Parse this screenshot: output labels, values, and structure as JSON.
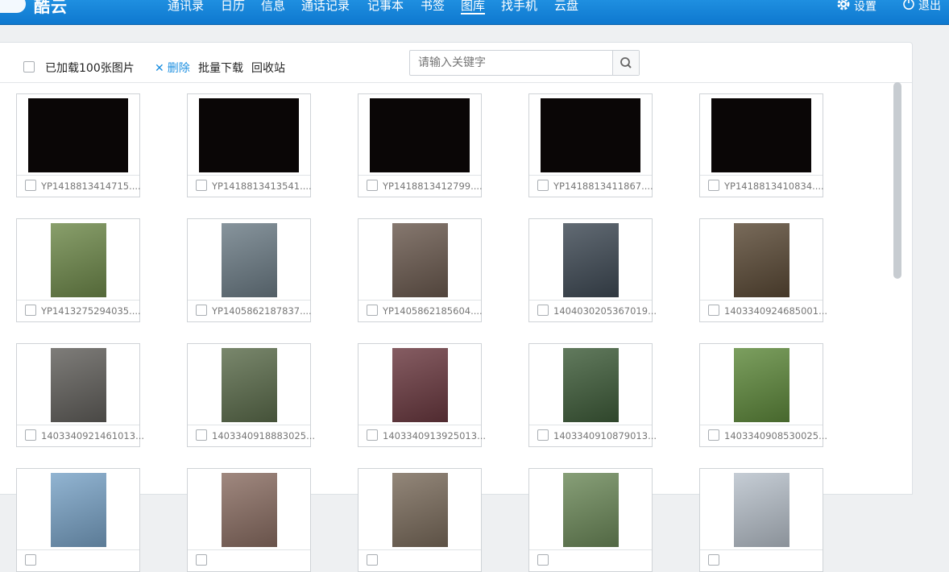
{
  "app": {
    "name": "酷云"
  },
  "nav": {
    "tabs": [
      {
        "label": "通讯录",
        "active": false
      },
      {
        "label": "日历",
        "active": false
      },
      {
        "label": "信息",
        "active": false
      },
      {
        "label": "通话记录",
        "active": false
      },
      {
        "label": "记事本",
        "active": false
      },
      {
        "label": "书签",
        "active": false
      },
      {
        "label": "图库",
        "active": true
      },
      {
        "label": "找手机",
        "active": false
      },
      {
        "label": "云盘",
        "active": false
      }
    ],
    "settings_label": "设置",
    "logout_label": "退出"
  },
  "toolbar": {
    "loaded_label": "已加载100张图片",
    "delete_label": "删除",
    "batch_download_label": "批量下载",
    "recycle_label": "回收站"
  },
  "search": {
    "placeholder": "请输入关键字",
    "value": ""
  },
  "photos": [
    {
      "name": "YP1418813414715....",
      "thumb_color": "#0a0606"
    },
    {
      "name": "YP1418813413541....",
      "thumb_color": "#0a0606"
    },
    {
      "name": "YP1418813412799....",
      "thumb_color": "#0a0606"
    },
    {
      "name": "YP1418813411867....",
      "thumb_color": "#0a0606"
    },
    {
      "name": "YP1418813410834....",
      "thumb_color": "#0a0606"
    },
    {
      "name": "YP1413275294035....",
      "thumb_color": "#6f8a4b"
    },
    {
      "name": "YP1405862187837....",
      "thumb_color": "#6d7d87"
    },
    {
      "name": "YP1405862185604....",
      "thumb_color": "#6b5a4f"
    },
    {
      "name": "1404030205367019...",
      "thumb_color": "#3f4a55"
    },
    {
      "name": "1403340924685001...",
      "thumb_color": "#5b4a36"
    },
    {
      "name": "1403340921461013...",
      "thumb_color": "#62605c"
    },
    {
      "name": "1403340918883025...",
      "thumb_color": "#5c6d4c"
    },
    {
      "name": "1403340913925013...",
      "thumb_color": "#6b3940"
    },
    {
      "name": "1403340910879013...",
      "thumb_color": "#3f5d3a"
    },
    {
      "name": "1403340908530025...",
      "thumb_color": "#5f8a3c"
    },
    {
      "name": "",
      "thumb_color": "#7aa4c8"
    },
    {
      "name": "",
      "thumb_color": "#8b6e63"
    },
    {
      "name": "",
      "thumb_color": "#7b6c5c"
    },
    {
      "name": "",
      "thumb_color": "#6d8a5a"
    },
    {
      "name": "",
      "thumb_color": "#b9c2cc"
    }
  ],
  "colors": {
    "topbar": "#1586d9",
    "accent": "#1a8ee0"
  }
}
